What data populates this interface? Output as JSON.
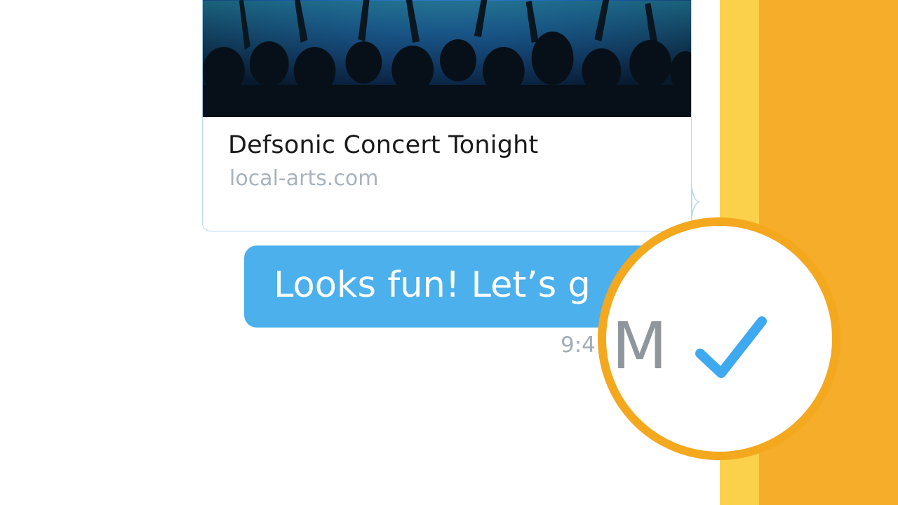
{
  "link_preview": {
    "title": "Defsonic Concert Tonight",
    "domain": "local-arts.com",
    "image_icon": "concert-crowd-photo"
  },
  "message": {
    "text": "Looks fun! Let’s g",
    "time": "9:4",
    "zoom_fragment": "M"
  },
  "magnifier": {
    "icon": "read-check-icon"
  },
  "colors": {
    "bubble": "#4cb0ec",
    "accent_orange": "#f5ad2a",
    "accent_yellow": "#fbd14b",
    "check": "#3ea9ef"
  }
}
